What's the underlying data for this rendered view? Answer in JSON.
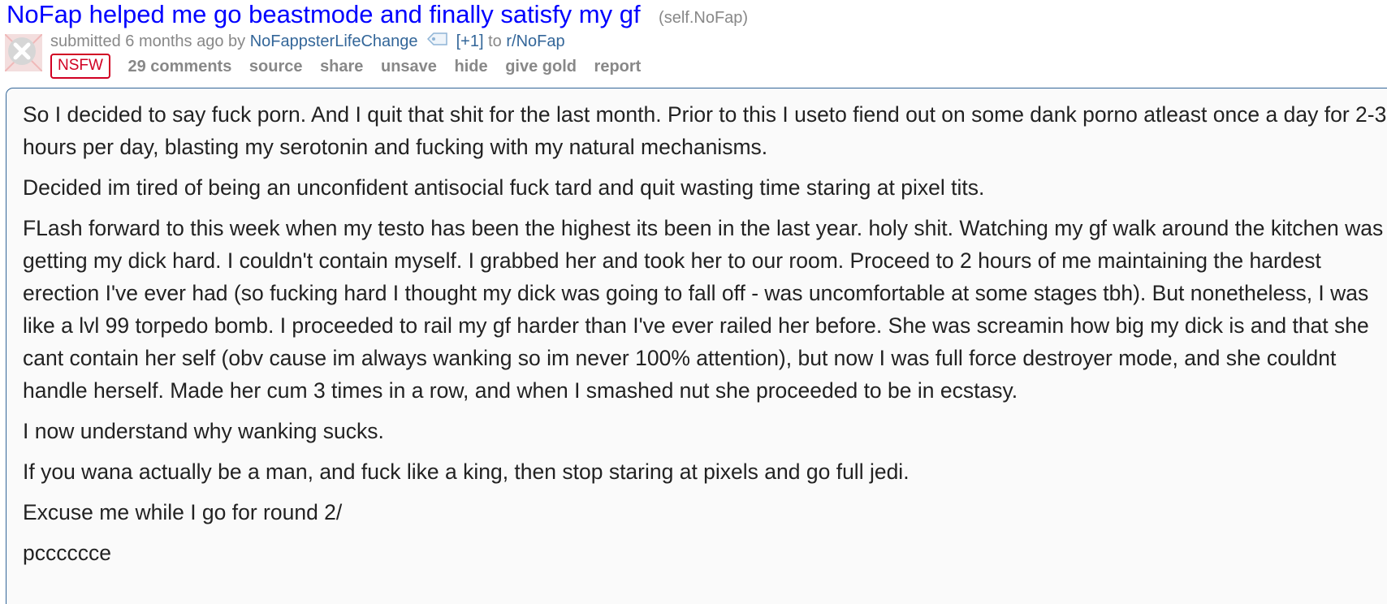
{
  "post": {
    "title": "NoFap helped me go beastmode and finally satisfy my gf",
    "domain": "(self.NoFap)",
    "thumbnail_icon": "nsfw-thumbnail-x-icon",
    "tagline": {
      "prefix": "submitted 6 months ago by",
      "author": "NoFappsterLifeChange",
      "author_flair_icon": "tag-icon",
      "flair": "[+1]",
      "to": "to",
      "subreddit": "r/NoFap"
    },
    "nsfw_label": "NSFW",
    "buttons": {
      "comments": "29 comments",
      "source": "source",
      "share": "share",
      "unsave": "unsave",
      "hide": "hide",
      "give_gold": "give gold",
      "report": "report"
    },
    "body": [
      "So I decided to say fuck porn. And I quit that shit for the last month. Prior to this I useto fiend out on some dank porno atleast once a day for 2-3 hours per day, blasting my serotonin and fucking with my natural mechanisms.",
      "Decided im tired of being an unconfident antisocial fuck tard and quit wasting time staring at pixel tits.",
      "FLash forward to this week when my testo has been the highest its been in the last year. holy shit. Watching my gf walk around the kitchen was getting my dick hard. I couldn't contain myself. I grabbed her and took her to our room. Proceed to 2 hours of me maintaining the hardest erection I've ever had (so fucking hard I thought my dick was going to fall off - was uncomfortable at some stages tbh). But nonetheless, I was like a lvl 99 torpedo bomb. I proceeded to rail my gf harder than I've ever railed her before. She was screamin how big my dick is and that she cant contain her self (obv cause im always wanking so im never 100% attention), but now I was full force destroyer mode, and she couldnt handle herself. Made her cum 3 times in a row, and when I smashed nut she proceeded to be in ecstasy.",
      "I now understand why wanking sucks.",
      "If you wana actually be a man, and fuck like a king, then stop staring at pixels and go full jedi.",
      "Excuse me while I go for round 2/",
      "pcccccce"
    ]
  },
  "colors": {
    "title_link": "#0000ff",
    "muted_text": "#888888",
    "user_link": "#336699",
    "nsfw": "#d10023",
    "selftext_border": "#336699",
    "selftext_bg": "#fafafa"
  }
}
